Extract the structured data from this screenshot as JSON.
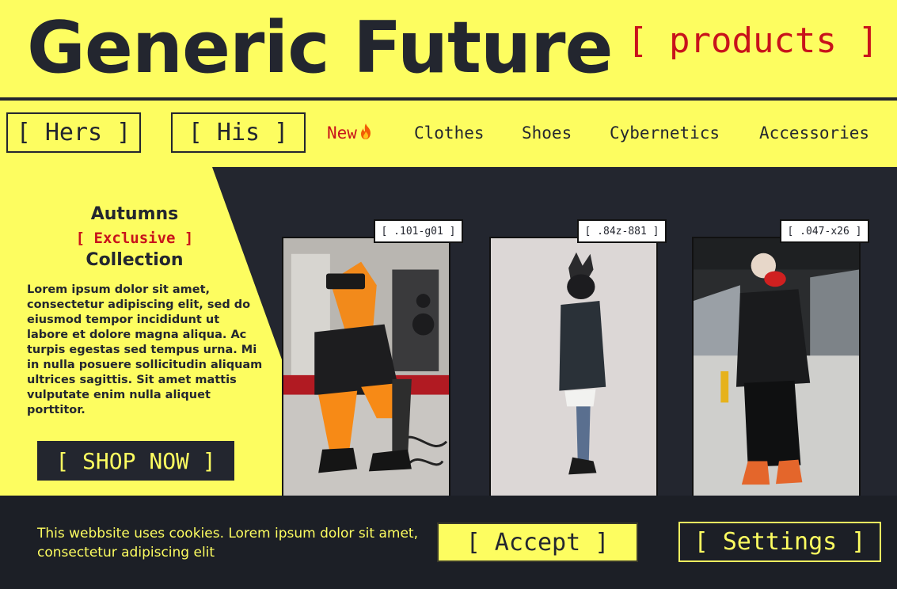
{
  "header": {
    "brand": "Generic Future",
    "brand_sub": "[ products ]"
  },
  "nav": {
    "hers": "[ Hers ]",
    "his": "[ His ]",
    "new": "New",
    "new_icon": "fire-icon",
    "links": [
      "Clothes",
      "Shoes",
      "Cybernetics",
      "Accessories"
    ]
  },
  "promo": {
    "title_top": "Autumns",
    "title_mid": "[ Exclusive ]",
    "title_bottom": "Collection",
    "body": "Lorem ipsum dolor sit amet, consectetur adipiscing elit, sed do eiusmod tempor incididunt ut labore et dolore magna aliqua. Ac turpis egestas sed tempus urna. Mi in nulla posuere sollicitudin aliquam ultrices sagittis. Sit amet mattis vulputate enim nulla aliquet porttitor.",
    "cta": "[ SHOP NOW ]"
  },
  "products": [
    {
      "tag": "[ .101-g01 ]"
    },
    {
      "tag": "[ .84z-881 ]"
    },
    {
      "tag": "[ .047-x26 ]"
    }
  ],
  "cookie": {
    "text": "This webbsite uses cookies. Lorem ipsum dolor sit amet, consectetur adipiscing elit",
    "accept": "[ Accept ]",
    "settings": "[ Settings ]"
  },
  "colors": {
    "accent": "#fdfd60",
    "dark": "#23262f",
    "red": "#c8131b"
  }
}
